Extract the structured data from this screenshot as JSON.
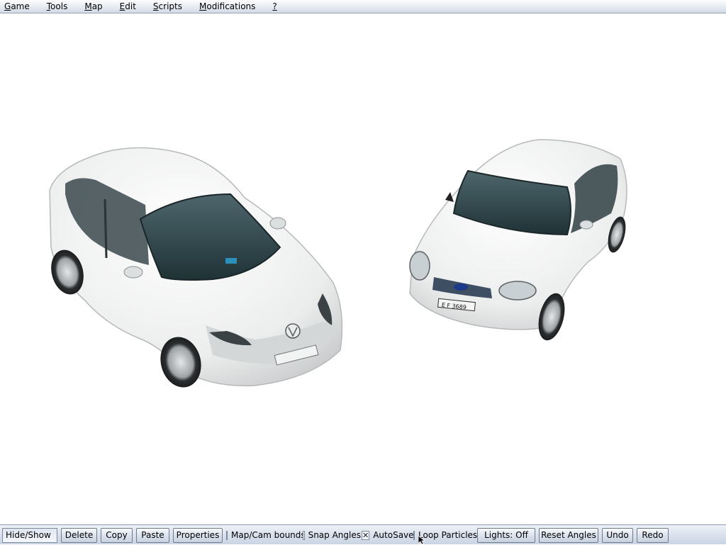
{
  "menu": {
    "items": [
      {
        "mnemonic": "G",
        "rest": "ame"
      },
      {
        "mnemonic": "T",
        "rest": "ools"
      },
      {
        "mnemonic": "M",
        "rest": "ap"
      },
      {
        "mnemonic": "E",
        "rest": "dit"
      },
      {
        "mnemonic": "S",
        "rest": "cripts"
      },
      {
        "mnemonic": "M",
        "rest": "odifications"
      },
      {
        "mnemonic": "?",
        "rest": ""
      }
    ]
  },
  "scene": {
    "background_color": "#ffffff",
    "car_left_plate": "",
    "car_right_plate": "E F 3689"
  },
  "toolbar": {
    "hide_show": "Hide/Show",
    "delete": "Delete",
    "copy": "Copy",
    "paste": "Paste",
    "properties": "Properties",
    "map_cam_bounds": {
      "label": "Map/Cam bounds",
      "checked": false
    },
    "snap_angles": {
      "label": "Snap Angles",
      "checked": false
    },
    "autosave": {
      "label": "AutoSave",
      "checked": true
    },
    "loop_particles": {
      "label": "Loop Particles",
      "checked": false
    },
    "lights": "Lights: Off",
    "reset_angles": "Reset Angles",
    "undo": "Undo",
    "redo": "Redo"
  }
}
